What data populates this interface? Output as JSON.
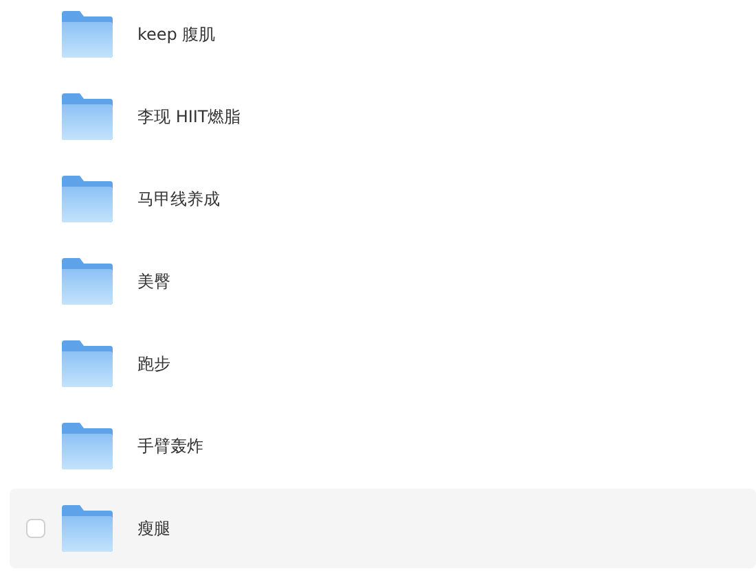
{
  "folders": [
    {
      "name": "keep 腹肌",
      "hovered": false,
      "checked": false
    },
    {
      "name": "李现 HIIT燃脂",
      "hovered": false,
      "checked": false
    },
    {
      "name": "马甲线养成",
      "hovered": false,
      "checked": false
    },
    {
      "name": "美臀",
      "hovered": false,
      "checked": false
    },
    {
      "name": "跑步",
      "hovered": false,
      "checked": false
    },
    {
      "name": "手臂轰炸",
      "hovered": false,
      "checked": false
    },
    {
      "name": "瘦腿",
      "hovered": true,
      "checked": false
    }
  ]
}
